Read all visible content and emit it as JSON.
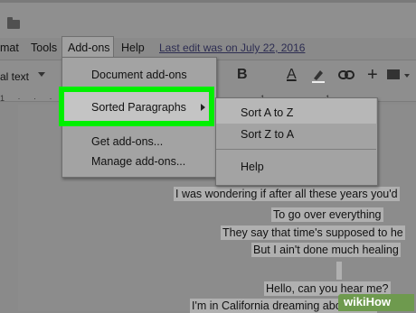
{
  "menubar": {
    "items": [
      "mat",
      "Tools",
      "Add-ons",
      "Help"
    ],
    "last_edit": "Last edit was on July 22, 2016"
  },
  "toolbar": {
    "style_value": "al text",
    "bold_label": "B",
    "text_color_label": "A",
    "link_icon": "link-icon",
    "insert_icon": "plus-icon",
    "image_icon": "image-icon"
  },
  "ruler": {
    "ticks": "1 · · · 1 · · · 1 · · · 1 · · · 1 · · · 1"
  },
  "addons_menu": {
    "items": [
      "Document add-ons",
      "Sorted Paragraphs",
      "Get add-ons...",
      "Manage add-ons..."
    ],
    "highlight_color": "#00f000"
  },
  "submenu": {
    "items": [
      "Sort A to Z",
      "Sort Z to A",
      "Help"
    ]
  },
  "document": {
    "lines": [
      "I was wondering if after all these years you'd",
      "To go over everything",
      "They say that time's supposed to he",
      "But I ain't done much healing",
      "Hello, can you hear me?",
      "I'm in California dreaming about who"
    ]
  },
  "watermark": {
    "text": "wikiHow"
  }
}
